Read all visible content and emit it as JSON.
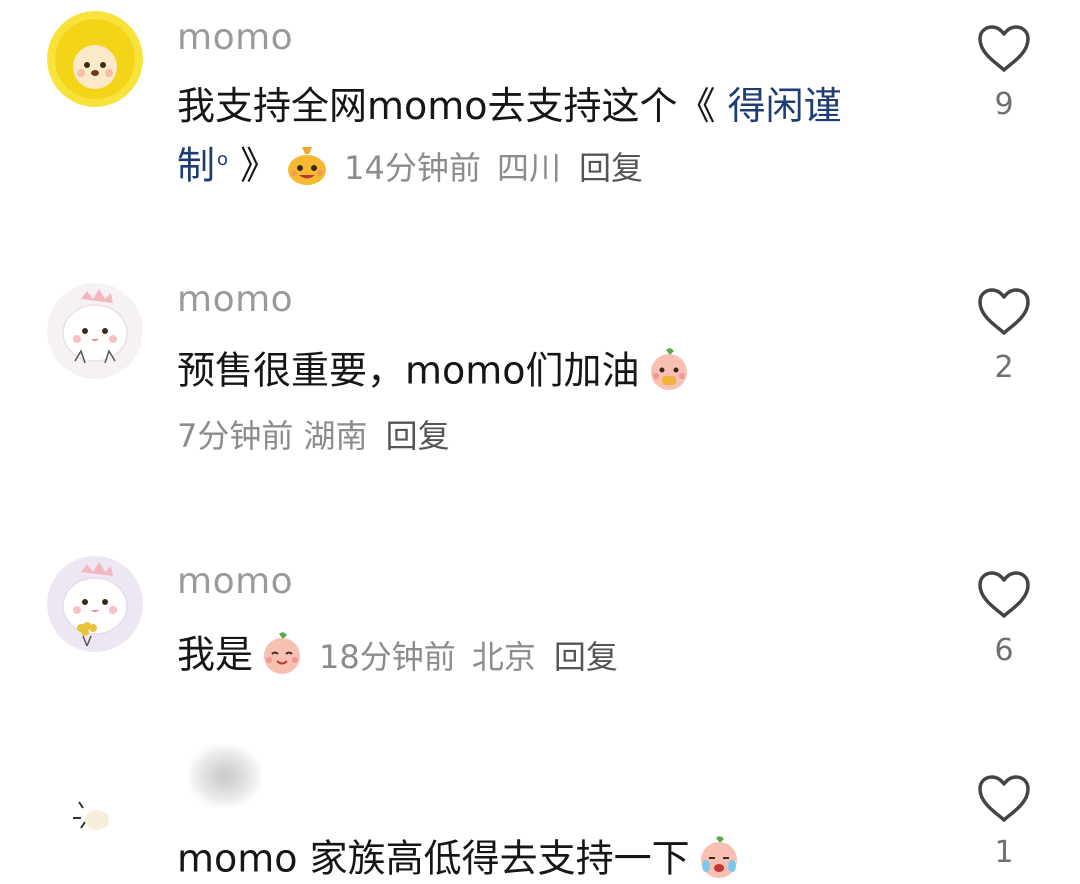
{
  "comments": [
    {
      "username": "momo",
      "text_before": "我支持全网momo去支持这个《 ",
      "link_line1": "得闲谨",
      "link_line2": "制",
      "text_after": " 》",
      "time": "14分钟前",
      "location": "四川",
      "reply": "回复",
      "likes": "9",
      "avatar_icon": "yellow-lion-avatar",
      "emoji_icon": "money-bag-emoji"
    },
    {
      "username": "momo",
      "text": "预售很重要，momo们加油",
      "time": "7分钟前",
      "location": "湖南",
      "reply": "回复",
      "likes": "2",
      "avatar_icon": "white-dino-avatar",
      "emoji_icon": "peach-cheer-emoji"
    },
    {
      "username": "momo",
      "text": "我是",
      "time": "18分钟前",
      "location": "北京",
      "reply": "回复",
      "likes": "6",
      "avatar_icon": "white-dino-flower-avatar",
      "emoji_icon": "peach-smile-emoji"
    },
    {
      "username": "",
      "text": "momo 家族高低得去支持一下",
      "likes": "1",
      "avatar_icon": "sparkle-avatar",
      "emoji_icon": "peach-cry-emoji"
    }
  ],
  "colors": {
    "username": "#9a9a9a",
    "text": "#161616",
    "link": "#1e3d75",
    "meta": "#8c8c8c",
    "reply": "#555555"
  }
}
